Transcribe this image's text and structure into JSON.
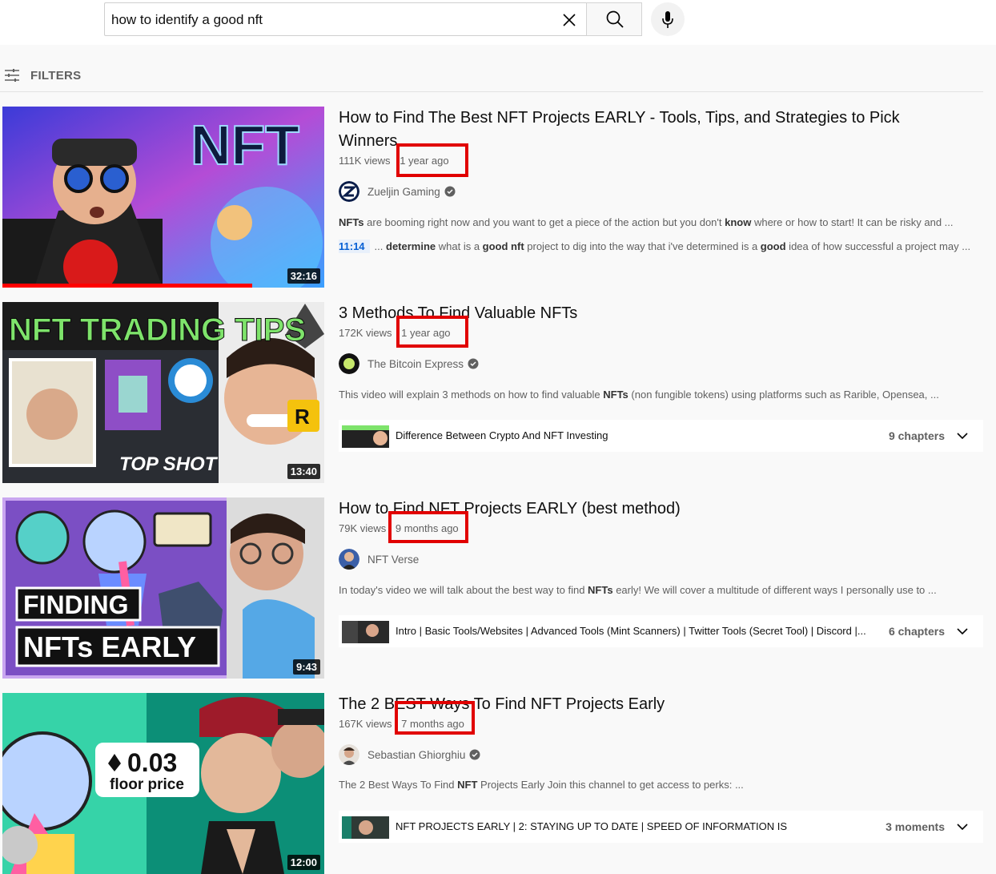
{
  "search": {
    "query": "how to identify a good nft"
  },
  "filters": {
    "label": "FILTERS"
  },
  "videos": [
    {
      "title": "How to Find The Best NFT Projects EARLY - Tools, Tips, and Strategies to Pick Winners",
      "views": "111K views",
      "age": "1 year ago",
      "channel": "Zueljin Gaming",
      "description": "<b>NFTs</b> are booming right now and you want to get a piece of the action but you don't <b>know</b> where or how to start! It can be risky and ...",
      "snippet_time": "11:14",
      "snippet": "... <b>determine</b> what is a <b>good nft</b> project to dig into the way that i've determined is a <b>good</b> idea of how successful a project may ...",
      "duration": "32:16",
      "thumb_text": "NFT"
    },
    {
      "title": "3 Methods To Find Valuable NFTs",
      "views": "172K views",
      "age": "1 year ago",
      "channel": "The Bitcoin Express",
      "description": "This video will explain 3 methods on how to find valuable <b>NFTs</b> (non fungible tokens) using platforms such as Rarible, Opensea, ...",
      "duration": "13:40",
      "thumb_text": "NFT TRADING TIPS",
      "thumb_sub": "TOP SHOT",
      "chapters_text": "Difference Between Crypto And NFT Investing",
      "chapters_count": "9 chapters"
    },
    {
      "title": "How to Find NFT Projects EARLY (best method)",
      "views": "79K views",
      "age": "9 months ago",
      "channel": "NFT Verse",
      "description": "In today's video we will talk about the best way to find <b>NFTs</b> early! We will cover a multitude of different ways I personally use to ...",
      "duration": "9:43",
      "thumb_text": "FINDING",
      "thumb_sub": "NFTs EARLY",
      "chapters_text": "Intro | Basic Tools/Websites | Advanced Tools (Mint Scanners) | Twitter Tools (Secret Tool) | Discord |...",
      "chapters_count": "6 chapters"
    },
    {
      "title": "The 2 BEST Ways To Find NFT Projects Early",
      "views": "167K views",
      "age": "7 months ago",
      "channel": "Sebastian Ghiorghiu",
      "description": "The 2 Best Ways To Find <b>NFT</b> Projects Early Join this channel to get access to perks: ...",
      "duration": "12:00",
      "thumb_text": "0.03",
      "thumb_sub": "floor price",
      "chapters_text": "NFT PROJECTS EARLY | 2: STAYING UP TO DATE | SPEED OF INFORMATION IS",
      "chapters_count": "3 moments"
    }
  ],
  "colors": {
    "highlight": "#e10000",
    "verified": "#606060"
  }
}
